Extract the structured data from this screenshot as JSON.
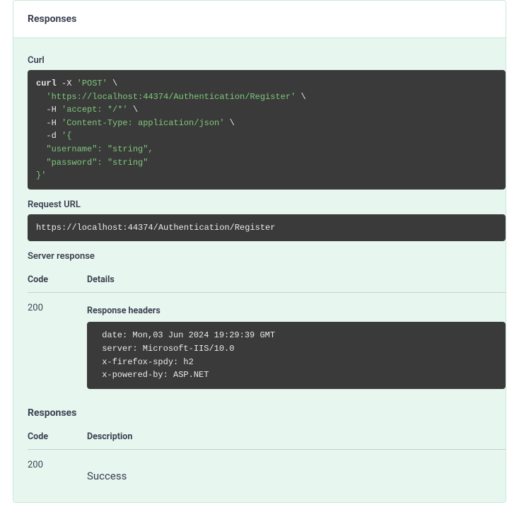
{
  "header": {
    "title": "Responses"
  },
  "curl": {
    "label": "Curl",
    "cmd": "curl",
    "flagX": "-X",
    "method": "'POST'",
    "bs": "\\",
    "url": "'https://localhost:44374/Authentication/Register'",
    "flagH1": "-H",
    "accept": "'accept: */*'",
    "flagH2": "-H",
    "ct": "'Content-Type: application/json'",
    "flagD": "-d",
    "bodyOpen": "'{",
    "bodyL1": "  \"username\": \"string\",",
    "bodyL2": "  \"password\": \"string\"",
    "bodyClose": "}'"
  },
  "requestUrl": {
    "label": "Request URL",
    "value": "https://localhost:44374/Authentication/Register"
  },
  "server": {
    "label": "Server response",
    "colCode": "Code",
    "colDetails": "Details",
    "code": "200",
    "respHeadersLabel": "Response headers",
    "headers": " date: Mon,03 Jun 2024 19:29:39 GMT \n server: Microsoft-IIS/10.0 \n x-firefox-spdy: h2 \n x-powered-by: ASP.NET "
  },
  "responses": {
    "label": "Responses",
    "colCode": "Code",
    "colDesc": "Description",
    "code": "200",
    "desc": "Success"
  }
}
